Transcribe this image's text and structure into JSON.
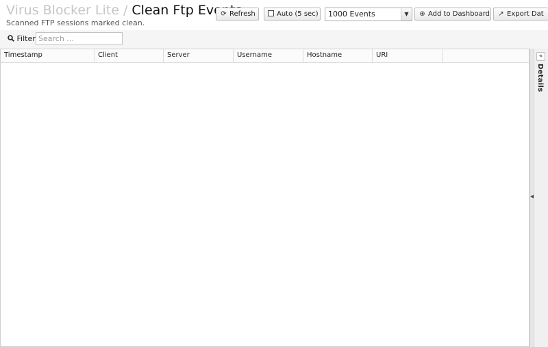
{
  "header": {
    "app_name": "Virus Blocker Lite",
    "separator": "/",
    "page_title": "Clean Ftp Events",
    "subtitle": "Scanned FTP sessions marked clean."
  },
  "toolbar": {
    "refresh_label": "Refresh",
    "auto_label": "Auto (5 sec)",
    "events_selected": "1000 Events",
    "add_dashboard_label": "Add to Dashboard",
    "export_label": "Export Dat"
  },
  "filter": {
    "label": "Filter",
    "placeholder": "Search ..."
  },
  "grid": {
    "columns": [
      "Timestamp",
      "Client",
      "Server",
      "Username",
      "Hostname",
      "URI",
      ""
    ],
    "rows": []
  },
  "details": {
    "label": "Details"
  },
  "icons": {
    "refresh": "refresh-icon",
    "checkbox": "checkbox-icon",
    "add": "plus-circle-icon",
    "export": "external-link-icon",
    "search": "search-icon",
    "chevron": "chevron-down-icon",
    "collapse": "double-chevron-left-icon"
  }
}
